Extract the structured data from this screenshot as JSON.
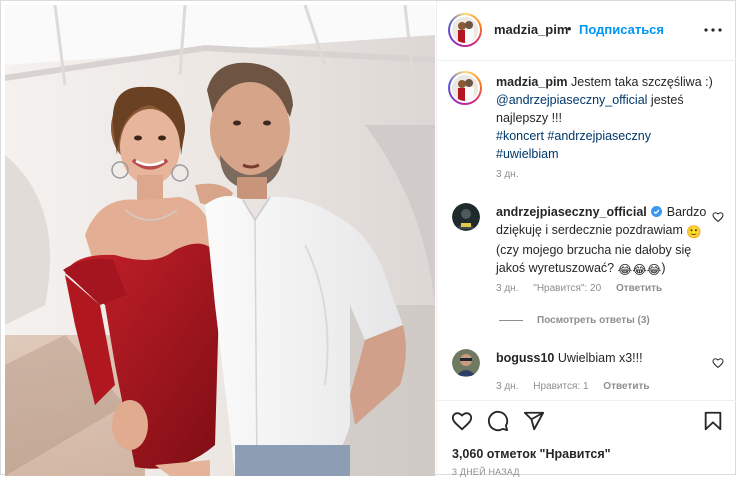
{
  "post": {
    "username": "madzia_pim",
    "dot": "•",
    "follow_label": "Подписаться",
    "more_icon": "more-horizontal-icon"
  },
  "caption": {
    "username": "madzia_pim",
    "text_1": "Jestem taka szczęśliwa :)",
    "mention": "@andrzejpiaseczny_official",
    "text_2": "jesteś najlepszy !!!",
    "hashtags_1": "#koncert #andrzejpiaseczny",
    "hashtags_2": "#uwielbiam",
    "time": "3 дн."
  },
  "comments": [
    {
      "username": "andrzejpiaseczny_official",
      "verified": true,
      "text_1": "Bardzo dziękuję i serdecznie pozdrawiam",
      "emoji_1": "🙂",
      "text_2": "(czy mojego brzucha nie dałoby się jakoś wyretuszować?",
      "emoji_2": "😂😂😂",
      "text_3": ")",
      "time": "3 дн.",
      "likes": "\"Нравится\": 20",
      "reply": "Ответить"
    },
    {
      "username": "boguss10",
      "text": "Uwielbiam x3!!!",
      "time": "3 дн.",
      "likes": "Нравится: 1",
      "reply": "Ответить"
    }
  ],
  "view_replies": "Посмотреть ответы (3)",
  "actions": {
    "like_icon": "heart-icon",
    "comment_icon": "comment-icon",
    "share_icon": "paper-plane-icon",
    "save_icon": "bookmark-icon"
  },
  "likes_text": "3,060 отметок \"Нравится\"",
  "posted_ago": "3 ДНЕЙ НАЗАД",
  "colors": {
    "link": "#00376b",
    "follow": "#0095f6",
    "muted": "#8e8e8e",
    "dress": "#b3141f"
  }
}
